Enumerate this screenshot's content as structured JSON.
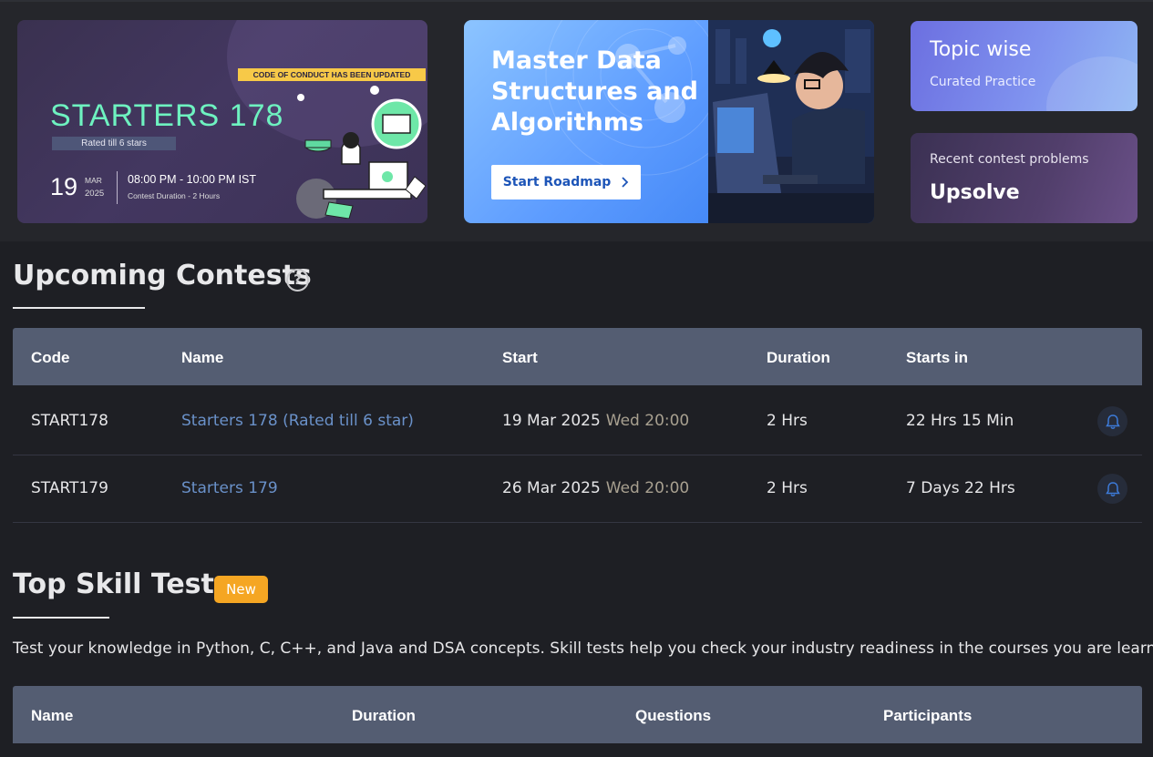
{
  "banners": {
    "starters": {
      "notice": "CODE OF CONDUCT HAS BEEN UPDATED",
      "title": "STARTERS 178",
      "rated": "Rated till 6 stars",
      "day": "19",
      "month": "MAR",
      "year": "2025",
      "time": "08:00 PM - 10:00 PM IST",
      "duration": "Contest Duration - 2 Hours"
    },
    "dsa": {
      "heading": "Master Data Structures and Algorithms",
      "button_label": "Start Roadmap"
    },
    "topic": {
      "title": "Topic wise",
      "subtitle": "Curated Practice"
    },
    "upsolve": {
      "subtitle": "Recent contest problems",
      "title": "Upsolve"
    }
  },
  "upcoming": {
    "title": "Upcoming Contests",
    "help_icon": "?",
    "columns": [
      "Code",
      "Name",
      "Start",
      "Duration",
      "Starts in"
    ],
    "rows": [
      {
        "code": "START178",
        "name": "Starters 178 (Rated till 6 star)",
        "date": "19 Mar 2025",
        "weekday_time": "Wed 20:00",
        "duration": "2 Hrs",
        "starts_in": "22 Hrs 15 Min"
      },
      {
        "code": "START179",
        "name": "Starters 179",
        "date": "26 Mar 2025",
        "weekday_time": "Wed 20:00",
        "duration": "2 Hrs",
        "starts_in": "7 Days 22 Hrs"
      }
    ]
  },
  "skill_tests": {
    "title": "Top Skill Tests",
    "badge": "New",
    "description": "Test your knowledge in Python, C, C++, and Java and DSA concepts. Skill tests help you check your industry readiness in the courses you are learning.",
    "columns": [
      "Name",
      "Duration",
      "Questions",
      "Participants"
    ]
  },
  "colors": {
    "background": "#1e1f24",
    "table_header": "#545d72",
    "link": "#6a91c9",
    "badge": "#f5a623",
    "starters_title": "#6ef2c0"
  },
  "icons": [
    "help-icon",
    "bell-icon",
    "chevron-right-icon"
  ]
}
